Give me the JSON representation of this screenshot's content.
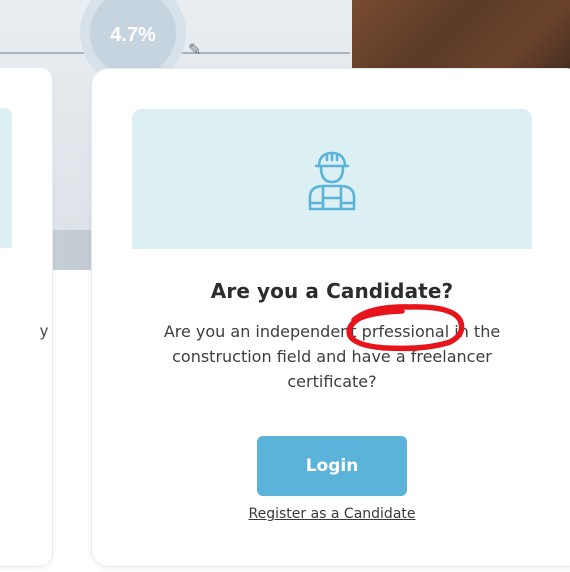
{
  "background": {
    "stat_value": "4.7%"
  },
  "left_card": {
    "stray_text": "y"
  },
  "card": {
    "icon": "construction-worker-icon",
    "title": "Are you a Candidate?",
    "description": "Are you an independent prfessional in the construction field and have a freelancer certificate?",
    "login_label": "Login",
    "register_label": "Register as a Candidate"
  },
  "colors": {
    "hero_bg": "#dcf0f3",
    "icon_stroke": "#5bb3da",
    "button_bg": "#5bb3da",
    "annotation": "#e8141b"
  },
  "annotation": {
    "shape": "red-ellipse",
    "highlighted_word": "prfessional"
  }
}
